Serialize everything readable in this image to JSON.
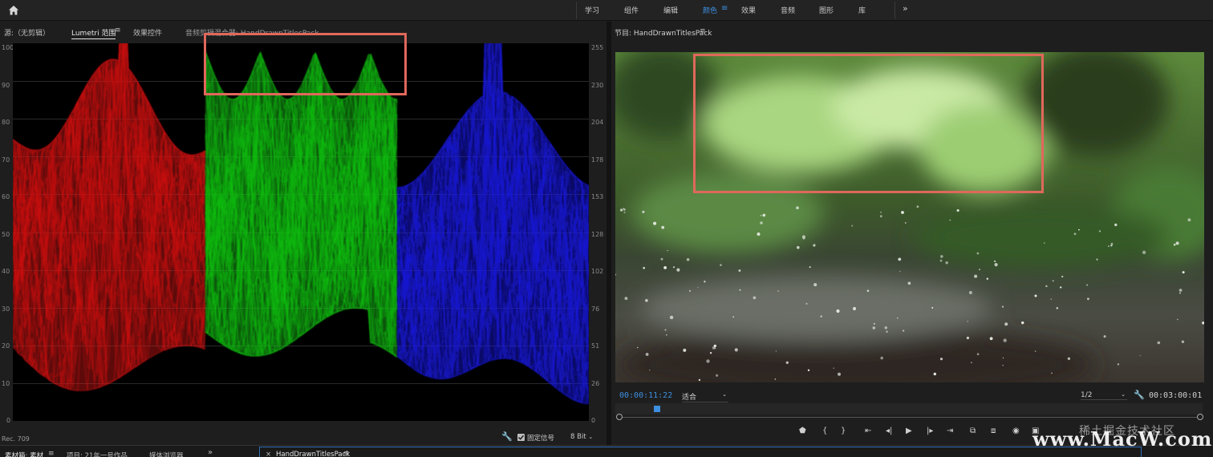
{
  "topbar": {
    "workspaces": [
      "学习",
      "组件",
      "编辑",
      "颜色",
      "效果",
      "音频",
      "图形",
      "库"
    ],
    "active_workspace": "颜色",
    "menu_glyph": "≡",
    "more_glyph": "»"
  },
  "left_panel": {
    "tabs": [
      {
        "label": "源:（无剪辑）"
      },
      {
        "label": "Lumetri 范围"
      },
      {
        "label": "效果控件"
      },
      {
        "label": "音频剪辑混合器: HandDrawnTitlesPack"
      }
    ],
    "active_tab": "Lumetri 范围",
    "scope": {
      "left_ticks": [
        "100",
        "90",
        "80",
        "70",
        "60",
        "50",
        "40",
        "30",
        "20",
        "10",
        "0"
      ],
      "right_ticks": [
        "255",
        "230",
        "204",
        "178",
        "153",
        "128",
        "102",
        "76",
        "51",
        "26",
        "0"
      ],
      "colorspace": "Rec. 709",
      "clamp_label": "固定信号",
      "clamp_checked": true,
      "bit_depth": "8 Bit"
    }
  },
  "program_monitor": {
    "title": "节目: HandDrawnTitlesPack",
    "timecode": "00:00:11:22",
    "fit": "适合",
    "resolution": "1/2",
    "duration": "00:03:00:01",
    "playhead_fraction": 0.06
  },
  "bottom": {
    "tabs": [
      "素材箱: 素材",
      "项目: 21年一号作品",
      "媒体浏览器"
    ],
    "sequence_tab": "HandDrawnTitlesPack",
    "more_glyph": "»"
  },
  "watermark": {
    "line1": "稀土掘金技术社区",
    "line2": "www.MacW.com"
  },
  "colors": {
    "accent": "#3d8fe0",
    "highlight_box": "#e0685b",
    "red_channel": "#d01010",
    "green_channel": "#10c010",
    "blue_channel": "#1818e0"
  }
}
